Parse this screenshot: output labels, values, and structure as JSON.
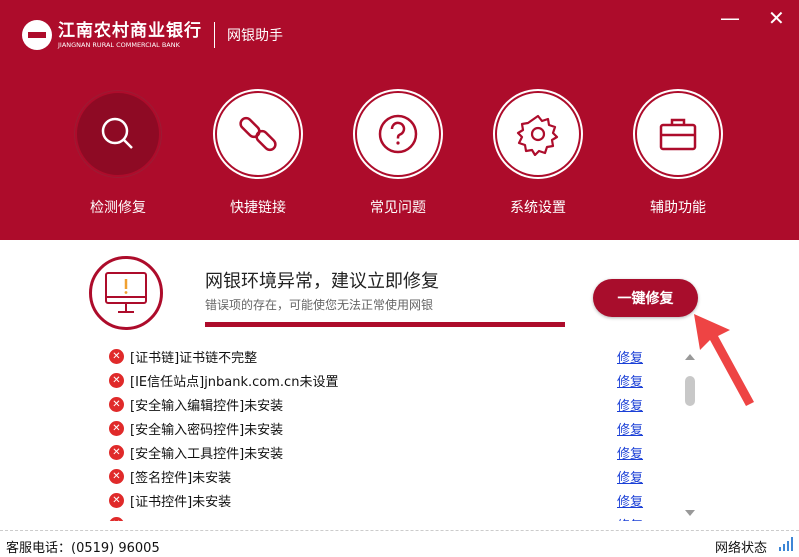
{
  "header": {
    "bank_name_cn": "江南农村商业银行",
    "bank_name_en": "JIANGNAN RURAL COMMERCIAL BANK",
    "app_name": "网银助手",
    "minimize": "—",
    "close": "✕"
  },
  "nav": [
    {
      "label": "检测修复",
      "icon": "search-icon",
      "active": true
    },
    {
      "label": "快捷链接",
      "icon": "link-icon"
    },
    {
      "label": "常见问题",
      "icon": "question-icon"
    },
    {
      "label": "系统设置",
      "icon": "gear-icon"
    },
    {
      "label": "辅助功能",
      "icon": "toolbox-icon"
    }
  ],
  "status": {
    "title": "网银环境异常，建议立即修复",
    "subtitle": "错误项的存在，可能使您无法正常使用网银",
    "progress_percent": 100,
    "fix_all": "一键修复",
    "accent": "#ad0c2b"
  },
  "items": [
    {
      "text": "[证书链]证书链不完整",
      "action": "修复"
    },
    {
      "text": "[IE信任站点]jnbank.com.cn未设置",
      "action": "修复"
    },
    {
      "text": "[安全输入编辑控件]未安装",
      "action": "修复"
    },
    {
      "text": "[安全输入密码控件]未安装",
      "action": "修复"
    },
    {
      "text": "[安全输入工具控件]未安装",
      "action": "修复"
    },
    {
      "text": "[签名控件]未安装",
      "action": "修复"
    },
    {
      "text": "[证书控件]未安装",
      "action": "修复"
    },
    {
      "text": "",
      "action": "修复"
    }
  ],
  "footer": {
    "phone": "客服电话：(0519) 96005",
    "network": "网络状态"
  }
}
